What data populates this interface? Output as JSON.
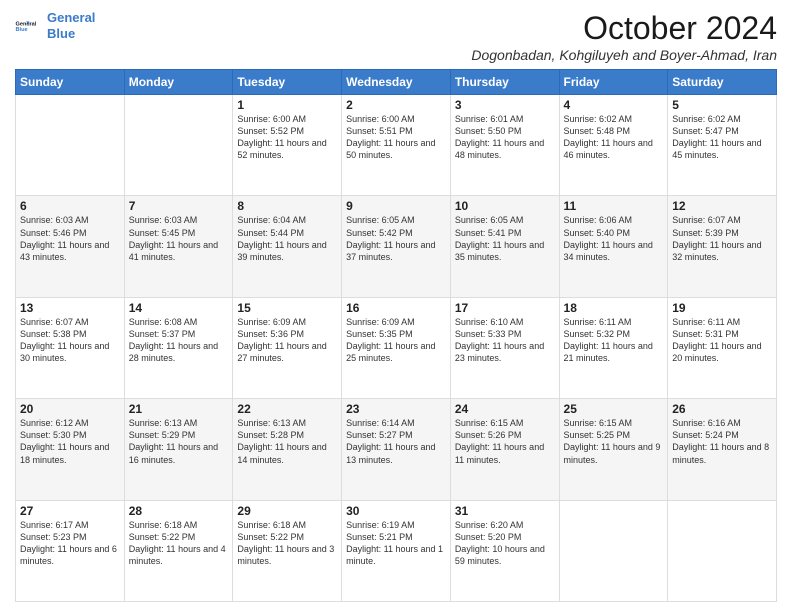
{
  "header": {
    "logo_line1": "General",
    "logo_line2": "Blue",
    "month": "October 2024",
    "location": "Dogonbadan, Kohgiluyeh and Boyer-Ahmad, Iran"
  },
  "days_of_week": [
    "Sunday",
    "Monday",
    "Tuesday",
    "Wednesday",
    "Thursday",
    "Friday",
    "Saturday"
  ],
  "weeks": [
    [
      {
        "day": "",
        "content": ""
      },
      {
        "day": "",
        "content": ""
      },
      {
        "day": "1",
        "content": "Sunrise: 6:00 AM\nSunset: 5:52 PM\nDaylight: 11 hours and 52 minutes."
      },
      {
        "day": "2",
        "content": "Sunrise: 6:00 AM\nSunset: 5:51 PM\nDaylight: 11 hours and 50 minutes."
      },
      {
        "day": "3",
        "content": "Sunrise: 6:01 AM\nSunset: 5:50 PM\nDaylight: 11 hours and 48 minutes."
      },
      {
        "day": "4",
        "content": "Sunrise: 6:02 AM\nSunset: 5:48 PM\nDaylight: 11 hours and 46 minutes."
      },
      {
        "day": "5",
        "content": "Sunrise: 6:02 AM\nSunset: 5:47 PM\nDaylight: 11 hours and 45 minutes."
      }
    ],
    [
      {
        "day": "6",
        "content": "Sunrise: 6:03 AM\nSunset: 5:46 PM\nDaylight: 11 hours and 43 minutes."
      },
      {
        "day": "7",
        "content": "Sunrise: 6:03 AM\nSunset: 5:45 PM\nDaylight: 11 hours and 41 minutes."
      },
      {
        "day": "8",
        "content": "Sunrise: 6:04 AM\nSunset: 5:44 PM\nDaylight: 11 hours and 39 minutes."
      },
      {
        "day": "9",
        "content": "Sunrise: 6:05 AM\nSunset: 5:42 PM\nDaylight: 11 hours and 37 minutes."
      },
      {
        "day": "10",
        "content": "Sunrise: 6:05 AM\nSunset: 5:41 PM\nDaylight: 11 hours and 35 minutes."
      },
      {
        "day": "11",
        "content": "Sunrise: 6:06 AM\nSunset: 5:40 PM\nDaylight: 11 hours and 34 minutes."
      },
      {
        "day": "12",
        "content": "Sunrise: 6:07 AM\nSunset: 5:39 PM\nDaylight: 11 hours and 32 minutes."
      }
    ],
    [
      {
        "day": "13",
        "content": "Sunrise: 6:07 AM\nSunset: 5:38 PM\nDaylight: 11 hours and 30 minutes."
      },
      {
        "day": "14",
        "content": "Sunrise: 6:08 AM\nSunset: 5:37 PM\nDaylight: 11 hours and 28 minutes."
      },
      {
        "day": "15",
        "content": "Sunrise: 6:09 AM\nSunset: 5:36 PM\nDaylight: 11 hours and 27 minutes."
      },
      {
        "day": "16",
        "content": "Sunrise: 6:09 AM\nSunset: 5:35 PM\nDaylight: 11 hours and 25 minutes."
      },
      {
        "day": "17",
        "content": "Sunrise: 6:10 AM\nSunset: 5:33 PM\nDaylight: 11 hours and 23 minutes."
      },
      {
        "day": "18",
        "content": "Sunrise: 6:11 AM\nSunset: 5:32 PM\nDaylight: 11 hours and 21 minutes."
      },
      {
        "day": "19",
        "content": "Sunrise: 6:11 AM\nSunset: 5:31 PM\nDaylight: 11 hours and 20 minutes."
      }
    ],
    [
      {
        "day": "20",
        "content": "Sunrise: 6:12 AM\nSunset: 5:30 PM\nDaylight: 11 hours and 18 minutes."
      },
      {
        "day": "21",
        "content": "Sunrise: 6:13 AM\nSunset: 5:29 PM\nDaylight: 11 hours and 16 minutes."
      },
      {
        "day": "22",
        "content": "Sunrise: 6:13 AM\nSunset: 5:28 PM\nDaylight: 11 hours and 14 minutes."
      },
      {
        "day": "23",
        "content": "Sunrise: 6:14 AM\nSunset: 5:27 PM\nDaylight: 11 hours and 13 minutes."
      },
      {
        "day": "24",
        "content": "Sunrise: 6:15 AM\nSunset: 5:26 PM\nDaylight: 11 hours and 11 minutes."
      },
      {
        "day": "25",
        "content": "Sunrise: 6:15 AM\nSunset: 5:25 PM\nDaylight: 11 hours and 9 minutes."
      },
      {
        "day": "26",
        "content": "Sunrise: 6:16 AM\nSunset: 5:24 PM\nDaylight: 11 hours and 8 minutes."
      }
    ],
    [
      {
        "day": "27",
        "content": "Sunrise: 6:17 AM\nSunset: 5:23 PM\nDaylight: 11 hours and 6 minutes."
      },
      {
        "day": "28",
        "content": "Sunrise: 6:18 AM\nSunset: 5:22 PM\nDaylight: 11 hours and 4 minutes."
      },
      {
        "day": "29",
        "content": "Sunrise: 6:18 AM\nSunset: 5:22 PM\nDaylight: 11 hours and 3 minutes."
      },
      {
        "day": "30",
        "content": "Sunrise: 6:19 AM\nSunset: 5:21 PM\nDaylight: 11 hours and 1 minute."
      },
      {
        "day": "31",
        "content": "Sunrise: 6:20 AM\nSunset: 5:20 PM\nDaylight: 10 hours and 59 minutes."
      },
      {
        "day": "",
        "content": ""
      },
      {
        "day": "",
        "content": ""
      }
    ]
  ]
}
